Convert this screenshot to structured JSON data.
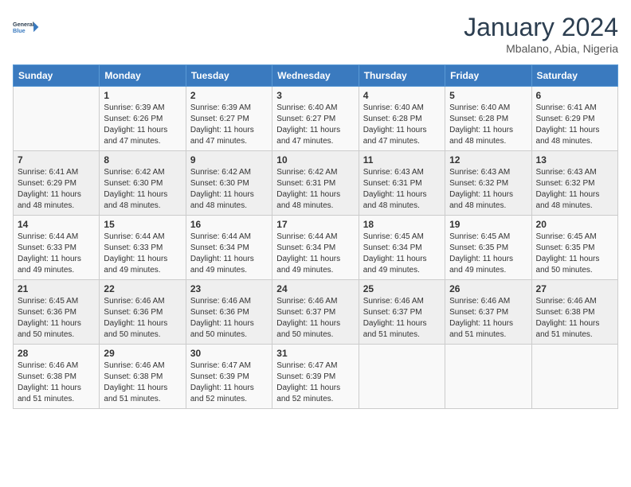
{
  "header": {
    "logo_line1": "General",
    "logo_line2": "Blue",
    "month_title": "January 2024",
    "location": "Mbalano, Abia, Nigeria"
  },
  "days_of_week": [
    "Sunday",
    "Monday",
    "Tuesday",
    "Wednesday",
    "Thursday",
    "Friday",
    "Saturday"
  ],
  "weeks": [
    [
      {
        "day": "",
        "content": ""
      },
      {
        "day": "1",
        "content": "Sunrise: 6:39 AM\nSunset: 6:26 PM\nDaylight: 11 hours and 47 minutes."
      },
      {
        "day": "2",
        "content": "Sunrise: 6:39 AM\nSunset: 6:27 PM\nDaylight: 11 hours and 47 minutes."
      },
      {
        "day": "3",
        "content": "Sunrise: 6:40 AM\nSunset: 6:27 PM\nDaylight: 11 hours and 47 minutes."
      },
      {
        "day": "4",
        "content": "Sunrise: 6:40 AM\nSunset: 6:28 PM\nDaylight: 11 hours and 47 minutes."
      },
      {
        "day": "5",
        "content": "Sunrise: 6:40 AM\nSunset: 6:28 PM\nDaylight: 11 hours and 48 minutes."
      },
      {
        "day": "6",
        "content": "Sunrise: 6:41 AM\nSunset: 6:29 PM\nDaylight: 11 hours and 48 minutes."
      }
    ],
    [
      {
        "day": "7",
        "content": "Sunrise: 6:41 AM\nSunset: 6:29 PM\nDaylight: 11 hours and 48 minutes."
      },
      {
        "day": "8",
        "content": "Sunrise: 6:42 AM\nSunset: 6:30 PM\nDaylight: 11 hours and 48 minutes."
      },
      {
        "day": "9",
        "content": "Sunrise: 6:42 AM\nSunset: 6:30 PM\nDaylight: 11 hours and 48 minutes."
      },
      {
        "day": "10",
        "content": "Sunrise: 6:42 AM\nSunset: 6:31 PM\nDaylight: 11 hours and 48 minutes."
      },
      {
        "day": "11",
        "content": "Sunrise: 6:43 AM\nSunset: 6:31 PM\nDaylight: 11 hours and 48 minutes."
      },
      {
        "day": "12",
        "content": "Sunrise: 6:43 AM\nSunset: 6:32 PM\nDaylight: 11 hours and 48 minutes."
      },
      {
        "day": "13",
        "content": "Sunrise: 6:43 AM\nSunset: 6:32 PM\nDaylight: 11 hours and 48 minutes."
      }
    ],
    [
      {
        "day": "14",
        "content": "Sunrise: 6:44 AM\nSunset: 6:33 PM\nDaylight: 11 hours and 49 minutes."
      },
      {
        "day": "15",
        "content": "Sunrise: 6:44 AM\nSunset: 6:33 PM\nDaylight: 11 hours and 49 minutes."
      },
      {
        "day": "16",
        "content": "Sunrise: 6:44 AM\nSunset: 6:34 PM\nDaylight: 11 hours and 49 minutes."
      },
      {
        "day": "17",
        "content": "Sunrise: 6:44 AM\nSunset: 6:34 PM\nDaylight: 11 hours and 49 minutes."
      },
      {
        "day": "18",
        "content": "Sunrise: 6:45 AM\nSunset: 6:34 PM\nDaylight: 11 hours and 49 minutes."
      },
      {
        "day": "19",
        "content": "Sunrise: 6:45 AM\nSunset: 6:35 PM\nDaylight: 11 hours and 49 minutes."
      },
      {
        "day": "20",
        "content": "Sunrise: 6:45 AM\nSunset: 6:35 PM\nDaylight: 11 hours and 50 minutes."
      }
    ],
    [
      {
        "day": "21",
        "content": "Sunrise: 6:45 AM\nSunset: 6:36 PM\nDaylight: 11 hours and 50 minutes."
      },
      {
        "day": "22",
        "content": "Sunrise: 6:46 AM\nSunset: 6:36 PM\nDaylight: 11 hours and 50 minutes."
      },
      {
        "day": "23",
        "content": "Sunrise: 6:46 AM\nSunset: 6:36 PM\nDaylight: 11 hours and 50 minutes."
      },
      {
        "day": "24",
        "content": "Sunrise: 6:46 AM\nSunset: 6:37 PM\nDaylight: 11 hours and 50 minutes."
      },
      {
        "day": "25",
        "content": "Sunrise: 6:46 AM\nSunset: 6:37 PM\nDaylight: 11 hours and 51 minutes."
      },
      {
        "day": "26",
        "content": "Sunrise: 6:46 AM\nSunset: 6:37 PM\nDaylight: 11 hours and 51 minutes."
      },
      {
        "day": "27",
        "content": "Sunrise: 6:46 AM\nSunset: 6:38 PM\nDaylight: 11 hours and 51 minutes."
      }
    ],
    [
      {
        "day": "28",
        "content": "Sunrise: 6:46 AM\nSunset: 6:38 PM\nDaylight: 11 hours and 51 minutes."
      },
      {
        "day": "29",
        "content": "Sunrise: 6:46 AM\nSunset: 6:38 PM\nDaylight: 11 hours and 51 minutes."
      },
      {
        "day": "30",
        "content": "Sunrise: 6:47 AM\nSunset: 6:39 PM\nDaylight: 11 hours and 52 minutes."
      },
      {
        "day": "31",
        "content": "Sunrise: 6:47 AM\nSunset: 6:39 PM\nDaylight: 11 hours and 52 minutes."
      },
      {
        "day": "",
        "content": ""
      },
      {
        "day": "",
        "content": ""
      },
      {
        "day": "",
        "content": ""
      }
    ]
  ]
}
